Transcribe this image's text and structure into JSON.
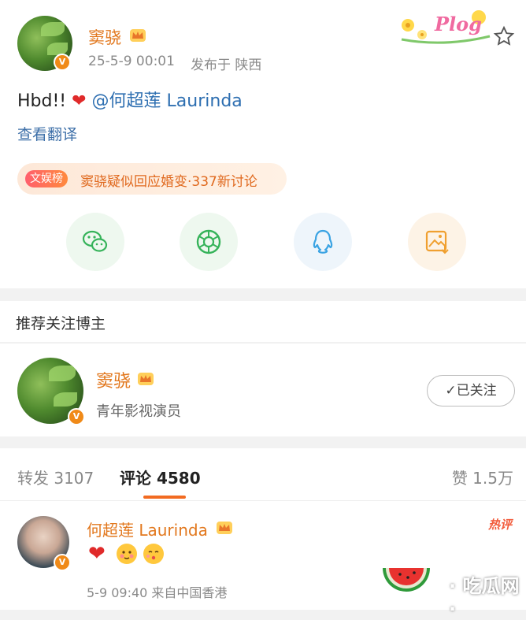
{
  "post": {
    "username": "窦骁",
    "date": "25-5-9 00:01",
    "location": "发布于 陕西",
    "text_prefix": "Hbd!! ",
    "heart": "❤",
    "mention": "@何超莲 Laurinda",
    "translate": "查看翻译",
    "topic_tag": "文娱榜",
    "topic_text": "窦骁疑似回应婚变·337新讨论",
    "sticker_text": "Plog",
    "share_icons": [
      "wechat-icon",
      "moments-icon",
      "qq-icon",
      "save-image-icon"
    ]
  },
  "recommend": {
    "title": "推荐关注博主",
    "username": "窦骁",
    "description": "青年影视演员",
    "follow_label": "✓已关注"
  },
  "comments": {
    "repost_label": "转发 3107",
    "comment_label": "评论 4580",
    "like_label": "赞 1.5万",
    "first": {
      "username": "何超莲 Laurinda",
      "hot": "热评",
      "heart": "❤",
      "time": "5-9 09:40 来自中国香港"
    }
  },
  "watermark": {
    "text": "· 吃瓜网 ·"
  },
  "colors": {
    "accent": "#f26b21",
    "username": "#e2781e",
    "link": "#2e6fb1"
  }
}
